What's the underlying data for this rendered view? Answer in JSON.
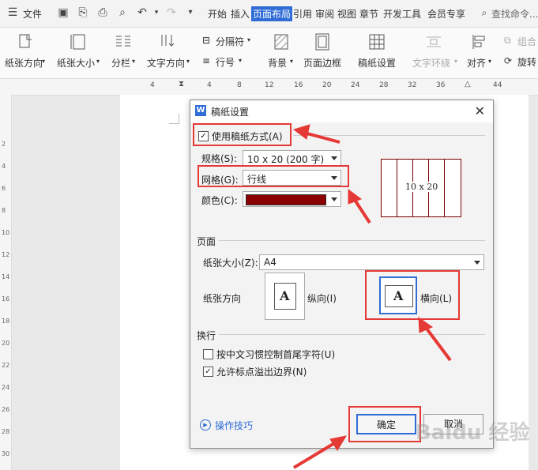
{
  "topbar": {
    "menu_label": "文件",
    "tabs": [
      "开始",
      "插入",
      "页面布局",
      "引用",
      "审阅",
      "视图",
      "章节",
      "开发工具",
      "会员专享"
    ],
    "search_placeholder": "查找命令..."
  },
  "ribbon": {
    "paper_direction": "纸张方向",
    "paper_size": "纸张大小",
    "columns": "分栏",
    "text_direction": "文字方向",
    "separator": "分隔符",
    "line_number": "行号",
    "background": "背景",
    "page_border": "页面边框",
    "draft_settings": "稿纸设置",
    "text_wrap": "文字环绕",
    "align": "对齐",
    "combine": "组合",
    "rotate": "旋转"
  },
  "ruler": {
    "h_ticks": [
      "4",
      "4",
      "8",
      "12",
      "16",
      "20",
      "24",
      "28",
      "32",
      "36",
      "44"
    ],
    "v_ticks": [
      "2",
      "4",
      "6",
      "8",
      "10",
      "12",
      "14",
      "16",
      "18",
      "20",
      "22",
      "24",
      "26",
      "28",
      "30"
    ]
  },
  "dialog": {
    "title": "稿纸设置",
    "use_draft": {
      "label": "使用稿纸方式(A)",
      "checked": true
    },
    "spec": {
      "label": "规格(S):",
      "value": "10 x 20 (200 字)"
    },
    "grid": {
      "label": "网格(G):",
      "value": "行线"
    },
    "color": {
      "label": "颜色(C):",
      "value": "#8b0000"
    },
    "preview_text": "10 x 20",
    "page_section": "页面",
    "paper_size": {
      "label": "纸张大小(Z):",
      "value": "A4"
    },
    "orientation_label": "纸张方向",
    "portrait": {
      "label": "纵向(I)",
      "glyph": "A"
    },
    "landscape": {
      "label": "横向(L)",
      "glyph": "A"
    },
    "wrap_section": "换行",
    "opt1": {
      "label": "按中文习惯控制首尾字符(U)",
      "checked": false
    },
    "opt2": {
      "label": "允许标点溢出边界(N)",
      "checked": true
    },
    "tips": "操作技巧",
    "ok": "确定",
    "cancel": "取消"
  },
  "watermark": "Baidu 经验"
}
